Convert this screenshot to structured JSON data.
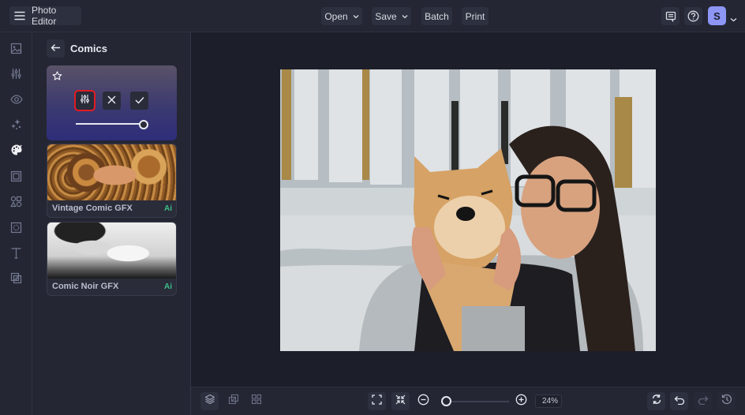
{
  "app": {
    "title": "Photo Editor",
    "menu": [
      {
        "label": "Open",
        "has_dropdown": true
      },
      {
        "label": "Save",
        "has_dropdown": true
      },
      {
        "label": "Batch",
        "has_dropdown": false
      },
      {
        "label": "Print",
        "has_dropdown": false
      }
    ],
    "user_initial": "S",
    "icons": {
      "app_menu": "hamburger-icon",
      "feedback": "feedback-icon",
      "help": "help-circle-icon",
      "account_dropdown": "chevron-down-icon"
    }
  },
  "rail": {
    "items": [
      {
        "name": "images",
        "icon": "image-icon",
        "active": false
      },
      {
        "name": "adjustments",
        "icon": "sliders-icon",
        "active": false
      },
      {
        "name": "touch-up",
        "icon": "eye-icon",
        "active": false
      },
      {
        "name": "ai-tools",
        "icon": "sparkles-icon",
        "active": false
      },
      {
        "name": "effects",
        "icon": "palette-icon",
        "active": true
      },
      {
        "name": "frames",
        "icon": "frame-icon",
        "active": false
      },
      {
        "name": "graphics",
        "icon": "shapes-icon",
        "active": false
      },
      {
        "name": "textures",
        "icon": "texture-icon",
        "active": false
      },
      {
        "name": "text",
        "icon": "text-icon",
        "active": false
      },
      {
        "name": "overlays",
        "icon": "overlay-icon",
        "active": false
      }
    ]
  },
  "panel": {
    "title": "Comics",
    "active_effect": {
      "intensity_percent": 100,
      "actions": [
        "settings",
        "cancel",
        "apply"
      ]
    },
    "effects": [
      {
        "label": "Vintage Comic GFX",
        "badge": "Ai"
      },
      {
        "label": "Comic Noir GFX",
        "badge": "Ai"
      }
    ]
  },
  "canvas": {
    "image_description": "Comic-style photo of a woman with glasses hugging a shiba inu dog in front of a white fence"
  },
  "bottombar": {
    "zoom_label": "24%",
    "zoom_fraction": 0.05,
    "left_tools": [
      "layers-icon",
      "copy-transform-icon",
      "grid-icon"
    ],
    "center_tools": [
      "fit-screen-icon",
      "shrink-icon",
      "zoom-out-icon",
      "zoom-in-icon"
    ],
    "right_tools": [
      "compare-icon",
      "undo-icon",
      "redo-icon",
      "history-icon"
    ]
  },
  "colors": {
    "accent": "#8d95f5",
    "highlight": "#e11b23",
    "ai_badge": "#3dbf8a",
    "background": "#1c1e29",
    "panel": "#242633"
  }
}
